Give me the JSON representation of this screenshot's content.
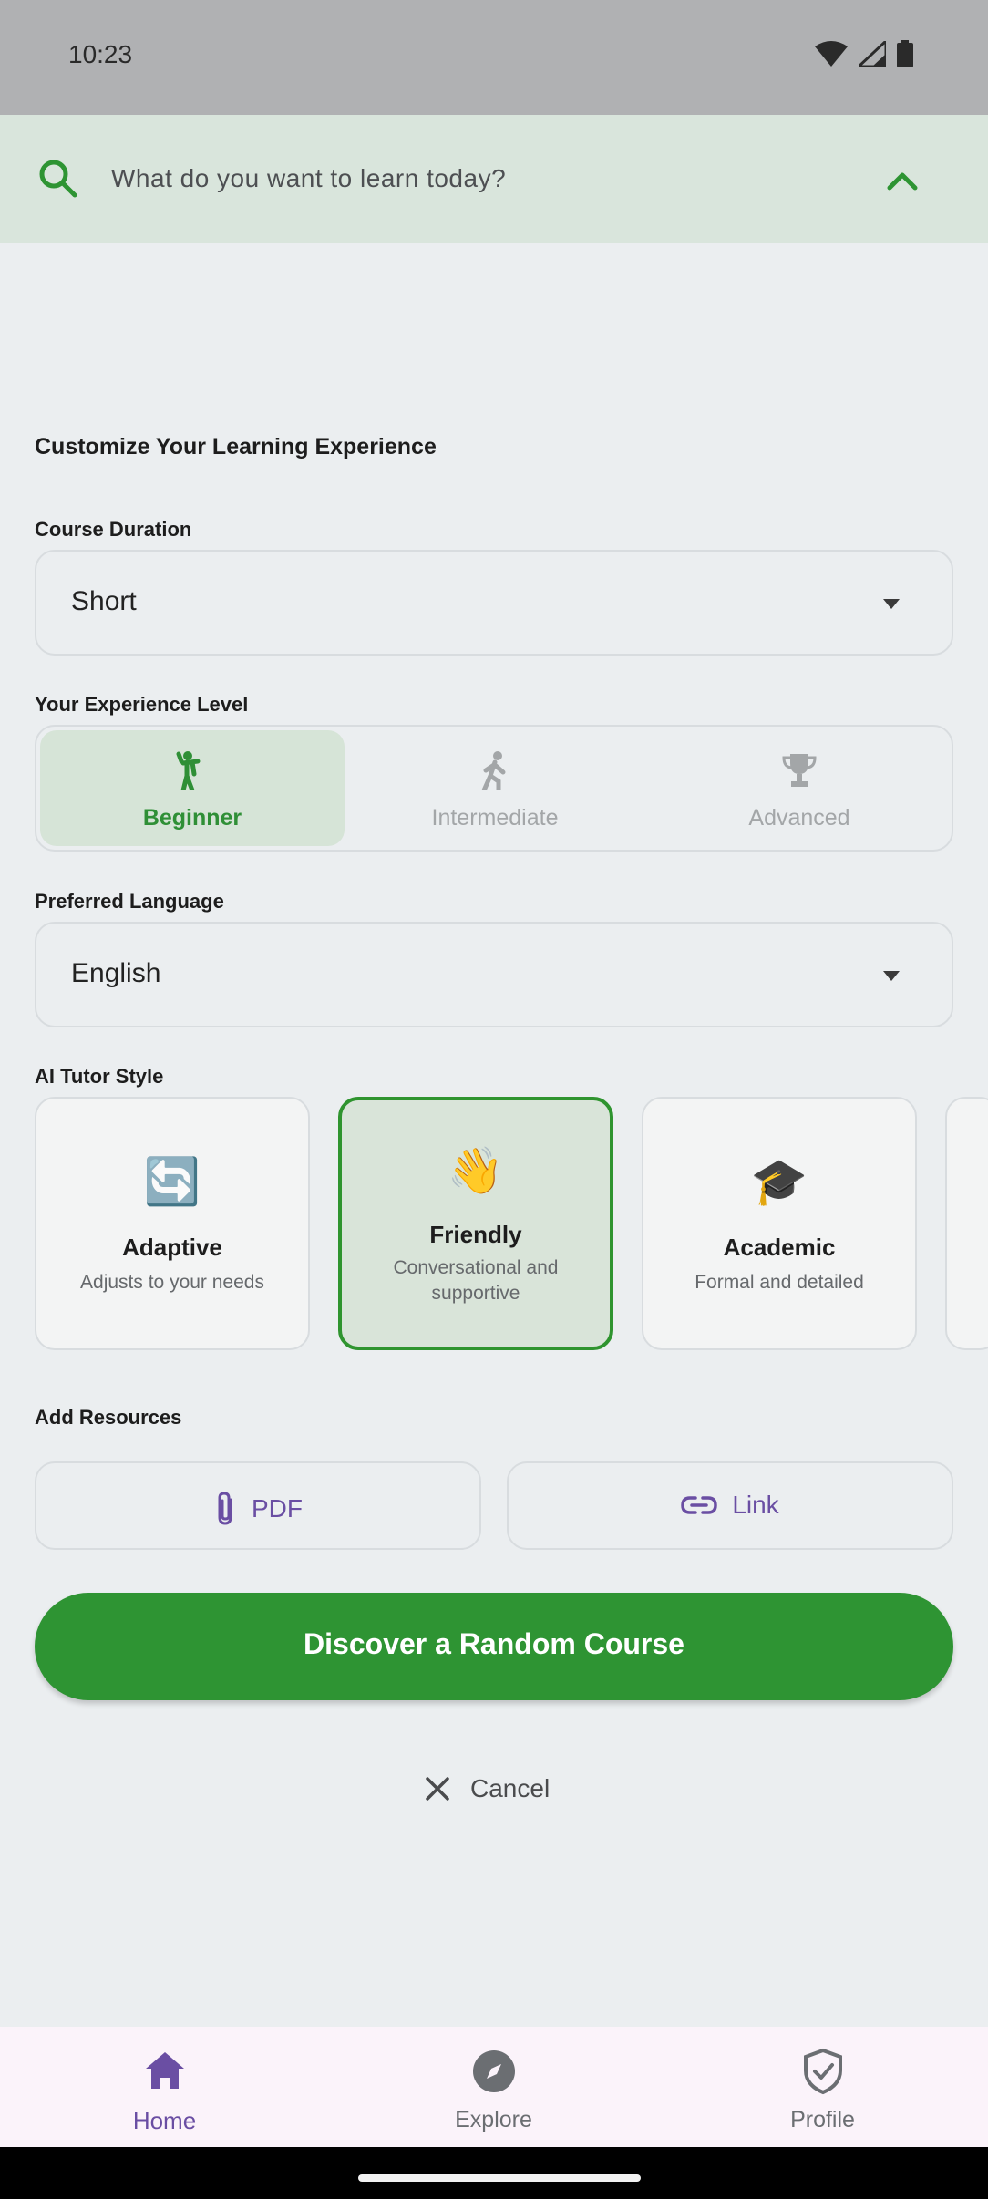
{
  "status_bar": {
    "time": "10:23"
  },
  "search": {
    "placeholder": "What do you want to learn today?"
  },
  "customize": {
    "title": "Customize Your Learning Experience",
    "duration": {
      "label": "Course Duration",
      "value": "Short"
    },
    "experience": {
      "label": "Your Experience Level",
      "options": [
        "Beginner",
        "Intermediate",
        "Advanced"
      ],
      "selected": "Beginner"
    },
    "language": {
      "label": "Preferred Language",
      "value": "English"
    },
    "tutor": {
      "label": "AI Tutor Style",
      "cards": [
        {
          "emoji": "🔄",
          "name": "Adaptive",
          "desc": "Adjusts to your needs"
        },
        {
          "emoji": "👋",
          "name": "Friendly",
          "desc": "Conversational and supportive"
        },
        {
          "emoji": "🎓",
          "name": "Academic",
          "desc": "Formal and detailed"
        }
      ],
      "selected": "Friendly"
    },
    "resources": {
      "label": "Add Resources",
      "pdf": "PDF",
      "link": "Link"
    }
  },
  "actions": {
    "discover": "Discover a Random Course",
    "cancel": "Cancel"
  },
  "nav": {
    "items": [
      "Home",
      "Explore",
      "Profile"
    ],
    "active": "Home"
  },
  "colors": {
    "accent_green": "#2e9433",
    "accent_purple": "#6a4ea3"
  }
}
